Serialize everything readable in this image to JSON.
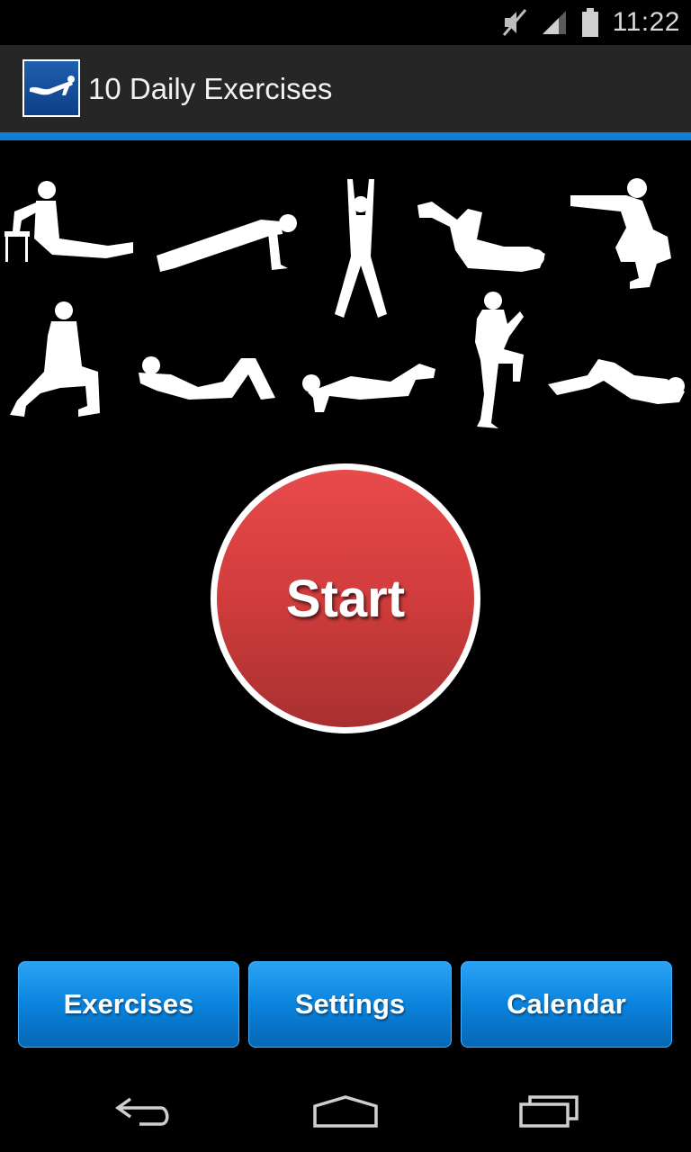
{
  "status_bar": {
    "time": "11:22",
    "icons": [
      "mute-icon",
      "signal-icon",
      "battery-icon"
    ]
  },
  "action_bar": {
    "title": "10 Daily Exercises",
    "app_icon": "pushup-logo-icon"
  },
  "exercises": [
    {
      "icon": "tricep-dip-icon"
    },
    {
      "icon": "push-up-icon"
    },
    {
      "icon": "jumping-jack-icon"
    },
    {
      "icon": "crunch-icon"
    },
    {
      "icon": "squat-icon"
    },
    {
      "icon": "lunge-icon"
    },
    {
      "icon": "sit-up-icon"
    },
    {
      "icon": "knee-push-up-icon"
    },
    {
      "icon": "high-knee-icon"
    },
    {
      "icon": "bicycle-crunch-icon"
    }
  ],
  "start_button": {
    "label": "Start"
  },
  "bottom_buttons": {
    "exercises_label": "Exercises",
    "settings_label": "Settings",
    "calendar_label": "Calendar"
  },
  "navigation": {
    "back": "back-icon",
    "home": "home-icon",
    "recents": "recents-icon"
  },
  "colors": {
    "accent_blue": "#0f7fd6",
    "start_red": "#d13c3c",
    "action_bar": "#262626"
  }
}
